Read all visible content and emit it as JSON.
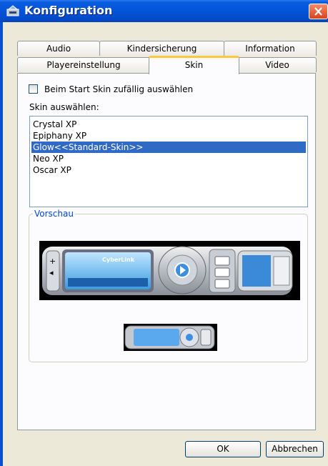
{
  "window": {
    "title": "Konfiguration"
  },
  "tabs": {
    "back_row": [
      "Audio",
      "Kindersicherung",
      "Information"
    ],
    "front_row": [
      "Playereinstellung",
      "Skin",
      "Video"
    ],
    "active": "Skin"
  },
  "skin": {
    "random_checkbox_label": "Beim Start Skin zufällig auswählen",
    "random_checked": false,
    "select_label": "Skin auswählen:",
    "items": [
      "Crystal XP",
      "Epiphany XP",
      "Glow<<Standard-Skin>>",
      "Neo XP",
      "Oscar XP"
    ],
    "selected": "Glow<<Standard-Skin>>"
  },
  "preview": {
    "label": "Vorschau",
    "logo_text": "CyberLink"
  },
  "buttons": {
    "ok": "OK",
    "cancel": "Abbrechen"
  },
  "colors": {
    "titlebar": "#0454d8",
    "selection": "#316ac5",
    "active_tab_accent": "#ffc73c",
    "group_label": "#0046d5"
  }
}
